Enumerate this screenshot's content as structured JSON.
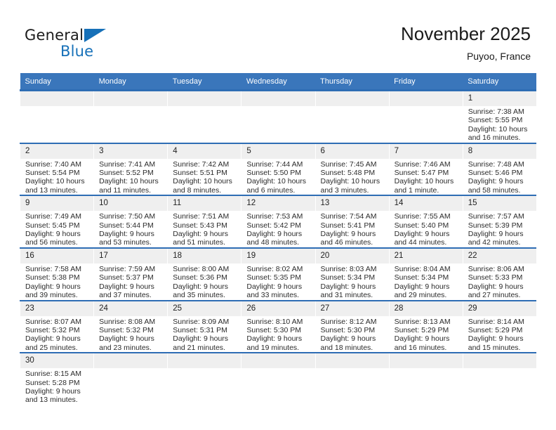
{
  "brand": {
    "name_part1": "General",
    "name_part2": "Blue",
    "flag_icon": "triangle-flag-icon",
    "accent_color": "#1670b8"
  },
  "header": {
    "title": "November 2025",
    "location": "Puyoo, France"
  },
  "theme": {
    "header_blue": "#3a76bb",
    "row_border_blue": "#2e6db4",
    "daynum_band": "#efefef"
  },
  "calendar": {
    "weekday_headers": [
      "Sunday",
      "Monday",
      "Tuesday",
      "Wednesday",
      "Thursday",
      "Friday",
      "Saturday"
    ],
    "weeks": [
      [
        {
          "day": "",
          "sunrise": "",
          "sunset": "",
          "daylight": "",
          "daylight2": ""
        },
        {
          "day": "",
          "sunrise": "",
          "sunset": "",
          "daylight": "",
          "daylight2": ""
        },
        {
          "day": "",
          "sunrise": "",
          "sunset": "",
          "daylight": "",
          "daylight2": ""
        },
        {
          "day": "",
          "sunrise": "",
          "sunset": "",
          "daylight": "",
          "daylight2": ""
        },
        {
          "day": "",
          "sunrise": "",
          "sunset": "",
          "daylight": "",
          "daylight2": ""
        },
        {
          "day": "",
          "sunrise": "",
          "sunset": "",
          "daylight": "",
          "daylight2": ""
        },
        {
          "day": "1",
          "sunrise": "Sunrise: 7:38 AM",
          "sunset": "Sunset: 5:55 PM",
          "daylight": "Daylight: 10 hours",
          "daylight2": "and 16 minutes."
        }
      ],
      [
        {
          "day": "2",
          "sunrise": "Sunrise: 7:40 AM",
          "sunset": "Sunset: 5:54 PM",
          "daylight": "Daylight: 10 hours",
          "daylight2": "and 13 minutes."
        },
        {
          "day": "3",
          "sunrise": "Sunrise: 7:41 AM",
          "sunset": "Sunset: 5:52 PM",
          "daylight": "Daylight: 10 hours",
          "daylight2": "and 11 minutes."
        },
        {
          "day": "4",
          "sunrise": "Sunrise: 7:42 AM",
          "sunset": "Sunset: 5:51 PM",
          "daylight": "Daylight: 10 hours",
          "daylight2": "and 8 minutes."
        },
        {
          "day": "5",
          "sunrise": "Sunrise: 7:44 AM",
          "sunset": "Sunset: 5:50 PM",
          "daylight": "Daylight: 10 hours",
          "daylight2": "and 6 minutes."
        },
        {
          "day": "6",
          "sunrise": "Sunrise: 7:45 AM",
          "sunset": "Sunset: 5:48 PM",
          "daylight": "Daylight: 10 hours",
          "daylight2": "and 3 minutes."
        },
        {
          "day": "7",
          "sunrise": "Sunrise: 7:46 AM",
          "sunset": "Sunset: 5:47 PM",
          "daylight": "Daylight: 10 hours",
          "daylight2": "and 1 minute."
        },
        {
          "day": "8",
          "sunrise": "Sunrise: 7:48 AM",
          "sunset": "Sunset: 5:46 PM",
          "daylight": "Daylight: 9 hours",
          "daylight2": "and 58 minutes."
        }
      ],
      [
        {
          "day": "9",
          "sunrise": "Sunrise: 7:49 AM",
          "sunset": "Sunset: 5:45 PM",
          "daylight": "Daylight: 9 hours",
          "daylight2": "and 56 minutes."
        },
        {
          "day": "10",
          "sunrise": "Sunrise: 7:50 AM",
          "sunset": "Sunset: 5:44 PM",
          "daylight": "Daylight: 9 hours",
          "daylight2": "and 53 minutes."
        },
        {
          "day": "11",
          "sunrise": "Sunrise: 7:51 AM",
          "sunset": "Sunset: 5:43 PM",
          "daylight": "Daylight: 9 hours",
          "daylight2": "and 51 minutes."
        },
        {
          "day": "12",
          "sunrise": "Sunrise: 7:53 AM",
          "sunset": "Sunset: 5:42 PM",
          "daylight": "Daylight: 9 hours",
          "daylight2": "and 48 minutes."
        },
        {
          "day": "13",
          "sunrise": "Sunrise: 7:54 AM",
          "sunset": "Sunset: 5:41 PM",
          "daylight": "Daylight: 9 hours",
          "daylight2": "and 46 minutes."
        },
        {
          "day": "14",
          "sunrise": "Sunrise: 7:55 AM",
          "sunset": "Sunset: 5:40 PM",
          "daylight": "Daylight: 9 hours",
          "daylight2": "and 44 minutes."
        },
        {
          "day": "15",
          "sunrise": "Sunrise: 7:57 AM",
          "sunset": "Sunset: 5:39 PM",
          "daylight": "Daylight: 9 hours",
          "daylight2": "and 42 minutes."
        }
      ],
      [
        {
          "day": "16",
          "sunrise": "Sunrise: 7:58 AM",
          "sunset": "Sunset: 5:38 PM",
          "daylight": "Daylight: 9 hours",
          "daylight2": "and 39 minutes."
        },
        {
          "day": "17",
          "sunrise": "Sunrise: 7:59 AM",
          "sunset": "Sunset: 5:37 PM",
          "daylight": "Daylight: 9 hours",
          "daylight2": "and 37 minutes."
        },
        {
          "day": "18",
          "sunrise": "Sunrise: 8:00 AM",
          "sunset": "Sunset: 5:36 PM",
          "daylight": "Daylight: 9 hours",
          "daylight2": "and 35 minutes."
        },
        {
          "day": "19",
          "sunrise": "Sunrise: 8:02 AM",
          "sunset": "Sunset: 5:35 PM",
          "daylight": "Daylight: 9 hours",
          "daylight2": "and 33 minutes."
        },
        {
          "day": "20",
          "sunrise": "Sunrise: 8:03 AM",
          "sunset": "Sunset: 5:34 PM",
          "daylight": "Daylight: 9 hours",
          "daylight2": "and 31 minutes."
        },
        {
          "day": "21",
          "sunrise": "Sunrise: 8:04 AM",
          "sunset": "Sunset: 5:34 PM",
          "daylight": "Daylight: 9 hours",
          "daylight2": "and 29 minutes."
        },
        {
          "day": "22",
          "sunrise": "Sunrise: 8:06 AM",
          "sunset": "Sunset: 5:33 PM",
          "daylight": "Daylight: 9 hours",
          "daylight2": "and 27 minutes."
        }
      ],
      [
        {
          "day": "23",
          "sunrise": "Sunrise: 8:07 AM",
          "sunset": "Sunset: 5:32 PM",
          "daylight": "Daylight: 9 hours",
          "daylight2": "and 25 minutes."
        },
        {
          "day": "24",
          "sunrise": "Sunrise: 8:08 AM",
          "sunset": "Sunset: 5:32 PM",
          "daylight": "Daylight: 9 hours",
          "daylight2": "and 23 minutes."
        },
        {
          "day": "25",
          "sunrise": "Sunrise: 8:09 AM",
          "sunset": "Sunset: 5:31 PM",
          "daylight": "Daylight: 9 hours",
          "daylight2": "and 21 minutes."
        },
        {
          "day": "26",
          "sunrise": "Sunrise: 8:10 AM",
          "sunset": "Sunset: 5:30 PM",
          "daylight": "Daylight: 9 hours",
          "daylight2": "and 19 minutes."
        },
        {
          "day": "27",
          "sunrise": "Sunrise: 8:12 AM",
          "sunset": "Sunset: 5:30 PM",
          "daylight": "Daylight: 9 hours",
          "daylight2": "and 18 minutes."
        },
        {
          "day": "28",
          "sunrise": "Sunrise: 8:13 AM",
          "sunset": "Sunset: 5:29 PM",
          "daylight": "Daylight: 9 hours",
          "daylight2": "and 16 minutes."
        },
        {
          "day": "29",
          "sunrise": "Sunrise: 8:14 AM",
          "sunset": "Sunset: 5:29 PM",
          "daylight": "Daylight: 9 hours",
          "daylight2": "and 15 minutes."
        }
      ],
      [
        {
          "day": "30",
          "sunrise": "Sunrise: 8:15 AM",
          "sunset": "Sunset: 5:28 PM",
          "daylight": "Daylight: 9 hours",
          "daylight2": "and 13 minutes."
        },
        {
          "day": "",
          "sunrise": "",
          "sunset": "",
          "daylight": "",
          "daylight2": ""
        },
        {
          "day": "",
          "sunrise": "",
          "sunset": "",
          "daylight": "",
          "daylight2": ""
        },
        {
          "day": "",
          "sunrise": "",
          "sunset": "",
          "daylight": "",
          "daylight2": ""
        },
        {
          "day": "",
          "sunrise": "",
          "sunset": "",
          "daylight": "",
          "daylight2": ""
        },
        {
          "day": "",
          "sunrise": "",
          "sunset": "",
          "daylight": "",
          "daylight2": ""
        },
        {
          "day": "",
          "sunrise": "",
          "sunset": "",
          "daylight": "",
          "daylight2": ""
        }
      ]
    ]
  }
}
